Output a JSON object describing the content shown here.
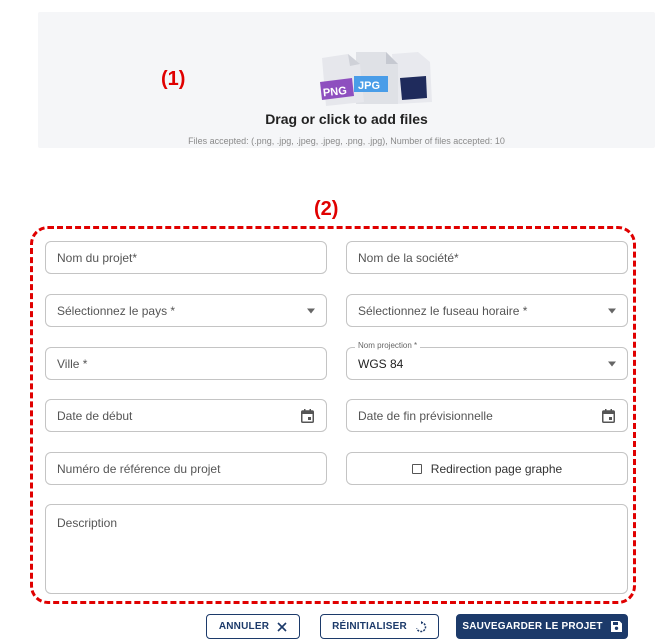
{
  "dropzone": {
    "title": "Drag or click to add files",
    "subtitle": "Files accepted: (.png, .jpg, .jpeg, .jpeg, .png, .jpg), Number of files accepted: 10",
    "badges": {
      "png": "PNG",
      "jpg": "JPG"
    }
  },
  "markers": {
    "one": "(1)",
    "two": "(2)"
  },
  "form": {
    "project_name": "Nom du projet*",
    "company_name": "Nom de la société*",
    "country": "Sélectionnez le pays *",
    "timezone": "Sélectionnez le fuseau horaire *",
    "city": "Ville *",
    "projection_label": "Nom projection *",
    "projection_value": "WGS 84",
    "start_date": "Date de début",
    "end_date": "Date de fin prévisionnelle",
    "reference": "Numéro de référence du projet",
    "redirect": "Redirection page graphe",
    "description": "Description"
  },
  "buttons": {
    "cancel": "ANNULER",
    "reset": "RÉINITIALISER",
    "save": "SAUVEGARDER LE PROJET"
  },
  "colors": {
    "accent": "#1c3a6a",
    "annotation": "#e00000",
    "png_badge": "#8e4fbf",
    "jpg_badge": "#4a9de8"
  }
}
